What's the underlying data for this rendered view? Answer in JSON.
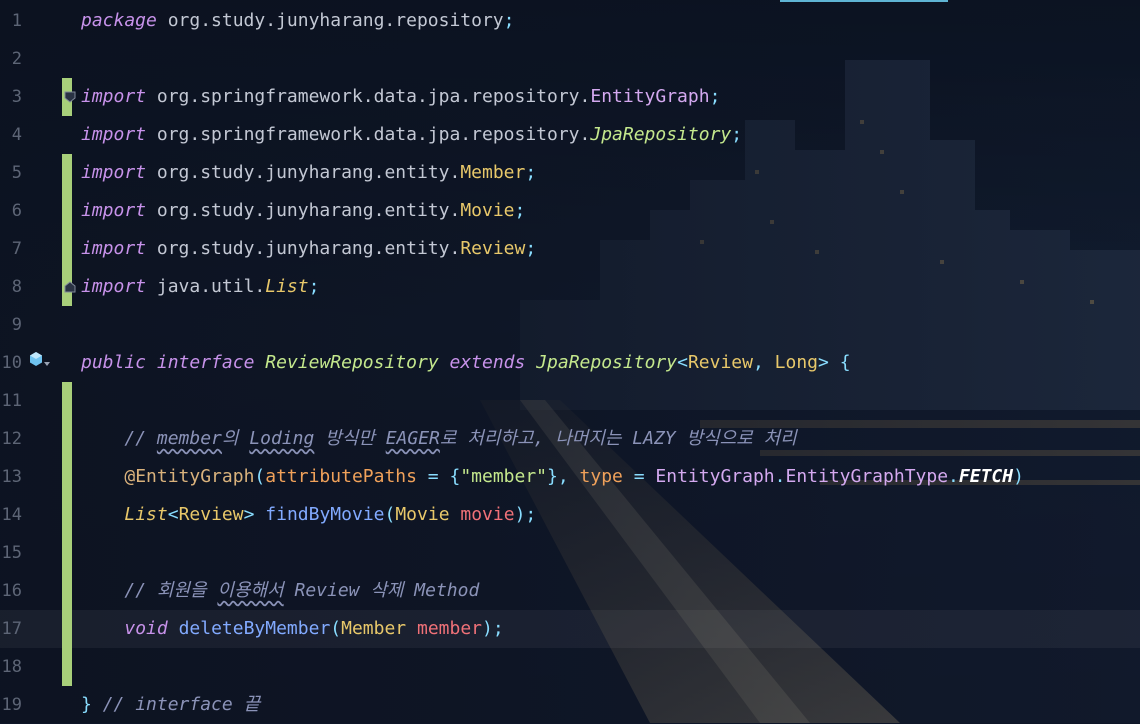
{
  "editor": {
    "language": "Java",
    "current_line": 17,
    "lines": [
      {
        "n": "1",
        "tokens": [
          {
            "c": "kw",
            "t": "package"
          },
          {
            "c": "pl",
            "t": " org.study.junyharang.repository"
          },
          {
            "c": "pu",
            "t": ";"
          }
        ]
      },
      {
        "n": "2",
        "tokens": []
      },
      {
        "n": "3",
        "tokens": [
          {
            "c": "kw",
            "t": "import"
          },
          {
            "c": "pl",
            "t": " org.springframework.data.jpa.repository."
          },
          {
            "c": "cl",
            "t": "EntityGraph"
          },
          {
            "c": "pu",
            "t": ";"
          }
        ]
      },
      {
        "n": "4",
        "tokens": [
          {
            "c": "kw",
            "t": "import"
          },
          {
            "c": "pl",
            "t": " org.springframework.data.jpa.repository."
          },
          {
            "c": "cli",
            "t": "JpaRepository"
          },
          {
            "c": "pu",
            "t": ";"
          }
        ]
      },
      {
        "n": "5",
        "tokens": [
          {
            "c": "kw",
            "t": "import"
          },
          {
            "c": "pl",
            "t": " org.study.junyharang.entity."
          },
          {
            "c": "t",
            "t": "Member"
          },
          {
            "c": "pu",
            "t": ";"
          }
        ]
      },
      {
        "n": "6",
        "tokens": [
          {
            "c": "kw",
            "t": "import"
          },
          {
            "c": "pl",
            "t": " org.study.junyharang.entity."
          },
          {
            "c": "t",
            "t": "Movie"
          },
          {
            "c": "pu",
            "t": ";"
          }
        ]
      },
      {
        "n": "7",
        "tokens": [
          {
            "c": "kw",
            "t": "import"
          },
          {
            "c": "pl",
            "t": " org.study.junyharang.entity."
          },
          {
            "c": "t",
            "t": "Review"
          },
          {
            "c": "pu",
            "t": ";"
          }
        ]
      },
      {
        "n": "8",
        "tokens": [
          {
            "c": "kw",
            "t": "import"
          },
          {
            "c": "pl",
            "t": " java.util."
          },
          {
            "c": "ti",
            "t": "List"
          },
          {
            "c": "pu",
            "t": ";"
          }
        ]
      },
      {
        "n": "9",
        "tokens": []
      },
      {
        "n": "10",
        "tokens": [
          {
            "c": "kw",
            "t": "public"
          },
          {
            "c": "pl",
            "t": " "
          },
          {
            "c": "kw",
            "t": "interface"
          },
          {
            "c": "pl",
            "t": " "
          },
          {
            "c": "cli",
            "t": "ReviewRepository"
          },
          {
            "c": "pl",
            "t": " "
          },
          {
            "c": "kw",
            "t": "extends"
          },
          {
            "c": "pl",
            "t": " "
          },
          {
            "c": "cli",
            "t": "JpaRepository"
          },
          {
            "c": "pu",
            "t": "<"
          },
          {
            "c": "t",
            "t": "Review"
          },
          {
            "c": "pu",
            "t": ", "
          },
          {
            "c": "t",
            "t": "Long"
          },
          {
            "c": "pu",
            "t": "> {"
          }
        ]
      },
      {
        "n": "11",
        "tokens": []
      },
      {
        "n": "12",
        "tokens": [
          {
            "c": "pl",
            "t": "    "
          },
          {
            "c": "cm",
            "t": "// "
          },
          {
            "c": "cm wavy",
            "t": "member"
          },
          {
            "c": "cm",
            "t": "의 "
          },
          {
            "c": "cm wavy",
            "t": "Loding"
          },
          {
            "c": "cm",
            "t": " 방식만 "
          },
          {
            "c": "cm wavy",
            "t": "EAGER"
          },
          {
            "c": "cm",
            "t": "로 처리하고, 나머지는 LAZY 방식으로 처리"
          }
        ]
      },
      {
        "n": "13",
        "tokens": [
          {
            "c": "pl",
            "t": "    "
          },
          {
            "c": "ann",
            "t": "@EntityGraph"
          },
          {
            "c": "pu",
            "t": "("
          },
          {
            "c": "an",
            "t": "attributePaths"
          },
          {
            "c": "pu",
            "t": " = {"
          },
          {
            "c": "st",
            "t": "\"member\""
          },
          {
            "c": "pu",
            "t": "}, "
          },
          {
            "c": "an",
            "t": "type"
          },
          {
            "c": "pu",
            "t": " = "
          },
          {
            "c": "cl",
            "t": "EntityGraph"
          },
          {
            "c": "pu",
            "t": "."
          },
          {
            "c": "cl",
            "t": "EntityGraphType"
          },
          {
            "c": "pu",
            "t": "."
          },
          {
            "c": "co",
            "t": "FETCH"
          },
          {
            "c": "pu",
            "t": ")"
          }
        ]
      },
      {
        "n": "14",
        "tokens": [
          {
            "c": "pl",
            "t": "    "
          },
          {
            "c": "ti",
            "t": "List"
          },
          {
            "c": "pu",
            "t": "<"
          },
          {
            "c": "t",
            "t": "Review"
          },
          {
            "c": "pu",
            "t": "> "
          },
          {
            "c": "fn",
            "t": "findByMovie"
          },
          {
            "c": "pu",
            "t": "("
          },
          {
            "c": "t",
            "t": "Movie"
          },
          {
            "c": "pl",
            "t": " "
          },
          {
            "c": "pa",
            "t": "movie"
          },
          {
            "c": "pu",
            "t": ");"
          }
        ]
      },
      {
        "n": "15",
        "tokens": []
      },
      {
        "n": "16",
        "tokens": [
          {
            "c": "pl",
            "t": "    "
          },
          {
            "c": "cm",
            "t": "// 회원을 "
          },
          {
            "c": "cm wavy",
            "t": "이용해서"
          },
          {
            "c": "cm",
            "t": " Review 삭제 Method"
          }
        ]
      },
      {
        "n": "17",
        "tokens": [
          {
            "c": "pl",
            "t": "    "
          },
          {
            "c": "kw",
            "t": "void"
          },
          {
            "c": "pl",
            "t": " "
          },
          {
            "c": "fn",
            "t": "deleteByMember"
          },
          {
            "c": "pu",
            "t": "("
          },
          {
            "c": "t",
            "t": "Member"
          },
          {
            "c": "pl",
            "t": " "
          },
          {
            "c": "pa",
            "t": "member"
          },
          {
            "c": "pu",
            "t": ");"
          }
        ]
      },
      {
        "n": "18",
        "tokens": []
      },
      {
        "n": "19",
        "tokens": [
          {
            "c": "pu",
            "t": "} "
          },
          {
            "c": "cm",
            "t": "// interface 끝"
          }
        ]
      }
    ]
  },
  "gutter": {
    "implementation_icon": "implemented-interface-icon",
    "fold_icon": "fold-icon",
    "change_color": "#a8cf7a"
  },
  "colors": {
    "keyword": "#c792ea",
    "type": "#e8c86a",
    "comment": "#8b93b8",
    "string": "#c4e88d",
    "method": "#82aaff",
    "parameter": "#f07178",
    "annotation_attribute": "#f0a15a"
  }
}
